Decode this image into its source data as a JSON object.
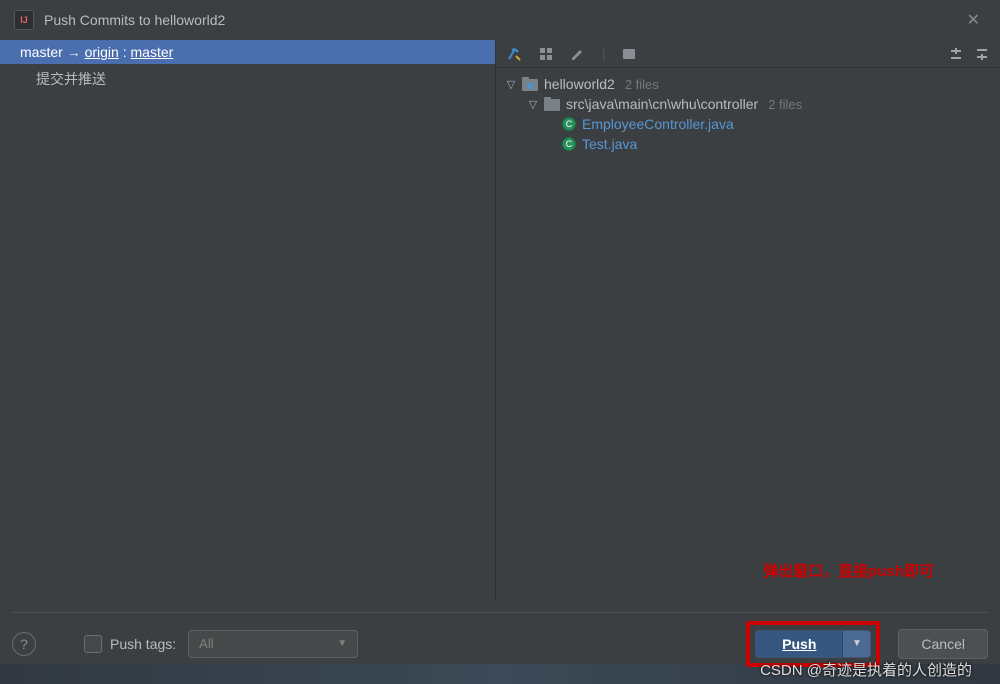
{
  "window": {
    "title": "Push Commits to helloworld2"
  },
  "left": {
    "branch_local": "master",
    "branch_arrow": "→",
    "branch_remote_name": "origin",
    "branch_colon": " : ",
    "branch_remote_branch": "master",
    "commit_message": "提交并推送"
  },
  "tree": {
    "root": {
      "label": "helloworld2",
      "count": "2 files"
    },
    "folder": {
      "label": "src\\java\\main\\cn\\whu\\controller",
      "count": "2 files"
    },
    "files": [
      {
        "label": "EmployeeController.java"
      },
      {
        "label": "Test.java"
      }
    ]
  },
  "footer": {
    "push_tags_label": "Push tags:",
    "push_tags_value": "All",
    "push_button": "Push",
    "cancel_button": "Cancel"
  },
  "annotation": "弹出窗口，直接push即可",
  "watermark": "CSDN @奇迹是执着的人创造的"
}
